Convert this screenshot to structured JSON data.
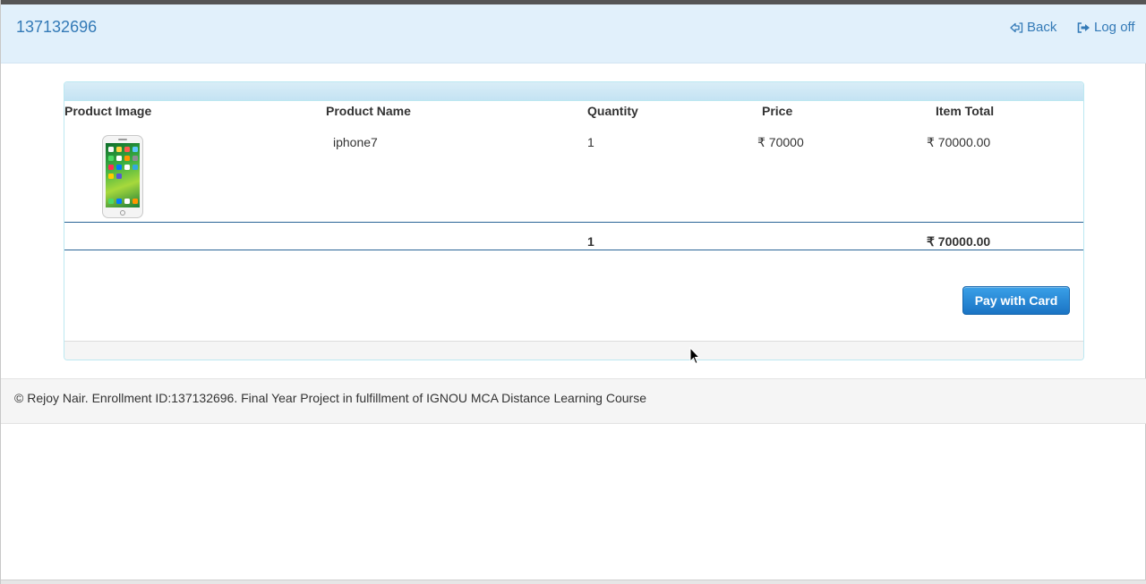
{
  "header": {
    "brand": "137132696",
    "back_label": "Back",
    "logoff_label": "Log off"
  },
  "cart": {
    "columns": [
      "Product Image",
      "Product Name",
      "Quantity",
      "Price",
      "Item Total"
    ],
    "rows": [
      {
        "image_icon": "iphone-icon",
        "name": "iphone7",
        "quantity": "1",
        "price": "₹ 70000",
        "item_total": "₹ 70000.00"
      }
    ],
    "totals": {
      "quantity": "1",
      "amount": "₹ 70000.00"
    },
    "pay_button_label": "Pay with Card"
  },
  "footer": {
    "text": "© Rejoy Nair. Enrollment ID:137132696. Final Year Project in fulfillment of IGNOU MCA Distance Learning Course"
  },
  "colors": {
    "header_bg": "#e1f0fb",
    "link": "#337ab7",
    "pay_button": "#1a74c4",
    "panel_border": "#bce8f1"
  }
}
